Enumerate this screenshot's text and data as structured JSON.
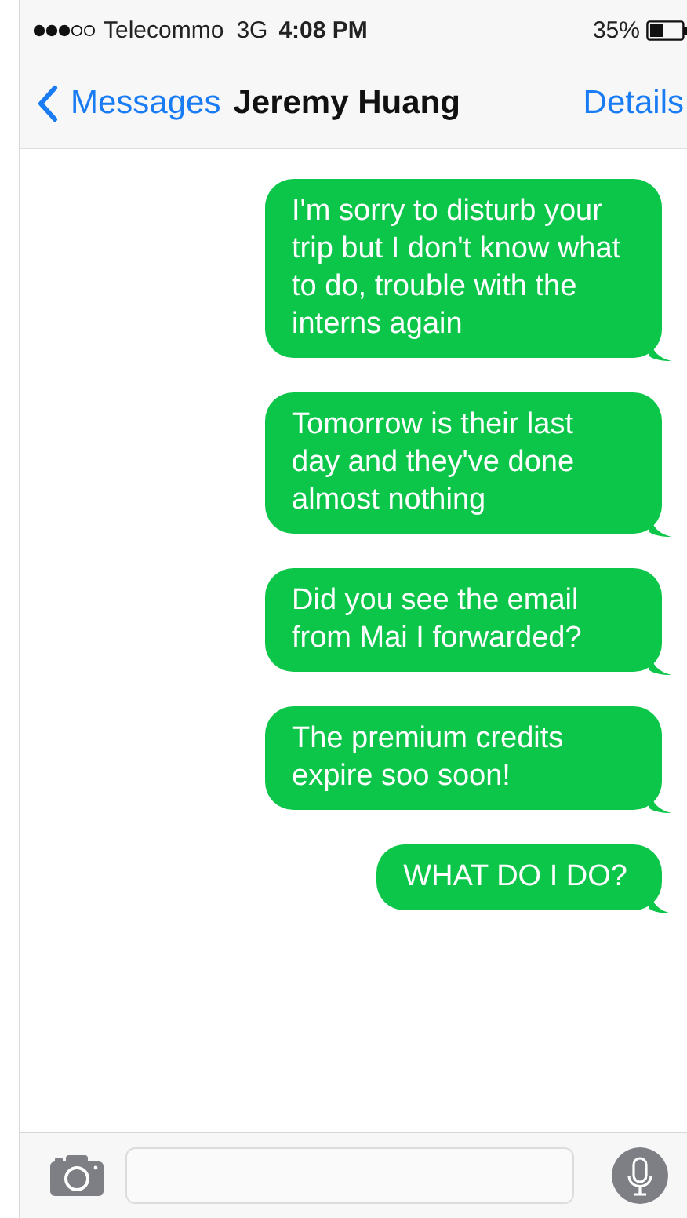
{
  "status_bar": {
    "carrier": "Telecommo",
    "network": "3G",
    "time": "4:08 PM",
    "battery": "35%"
  },
  "nav": {
    "back": "Messages",
    "title": "Jeremy Huang",
    "action": "Details"
  },
  "messages": [
    {
      "text": "I'm sorry to disturb your trip but I don't know what to do, trouble with the interns again"
    },
    {
      "text": "Tomorrow is their last day and they've done almost nothing"
    },
    {
      "text": "Did you see the email from Mai I forwarded?"
    },
    {
      "text": "The premium credits expire soo soon!"
    },
    {
      "text": "WHAT DO I DO?"
    }
  ]
}
